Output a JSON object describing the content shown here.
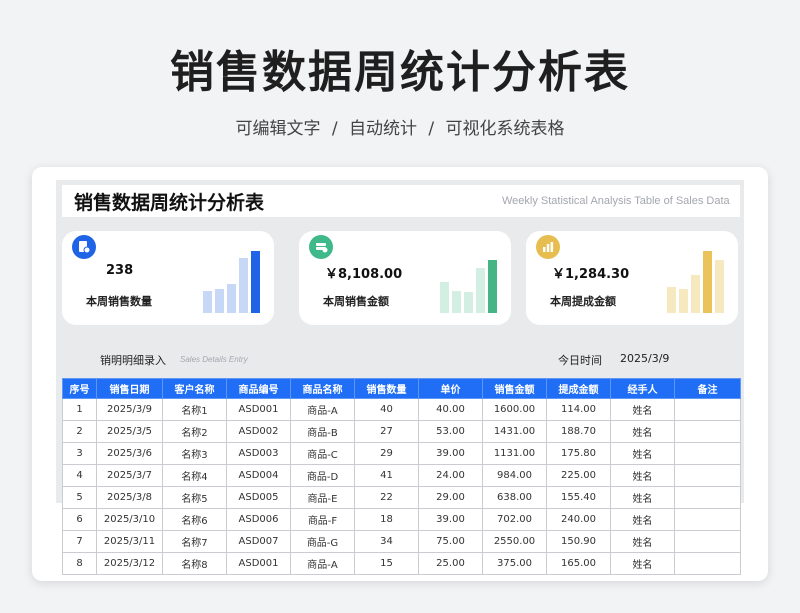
{
  "header": {
    "title": "销售数据周统计分析表",
    "subtitle": "可编辑文字 / 自动统计 / 可视化系统表格"
  },
  "sheet": {
    "title": "销售数据周统计分析表",
    "subtitle": "Weekly Statistical Analysis Table of Sales Data"
  },
  "kpis": [
    {
      "value": "238",
      "label": "本周销售数量",
      "icon": "document-user-icon",
      "accent": "#1f63e6",
      "bar_color": "#c6d8f6",
      "bar_last_color": "#1f63e6",
      "bars": [
        0.36,
        0.38,
        0.46,
        0.88,
        1.0
      ]
    },
    {
      "value": "￥8,108.00",
      "label": "本周销售金额",
      "icon": "money-stack-icon",
      "accent": "#3fb88a",
      "bar_color": "#d3eee2",
      "bar_last_color": "#45b585",
      "bars": [
        0.5,
        0.36,
        0.34,
        0.72,
        0.86
      ]
    },
    {
      "value": "￥1,284.30",
      "label": "本周提成金额",
      "icon": "bar-chart-icon",
      "accent": "#e7bd4f",
      "bar_color": "#f7e9bf",
      "bar_last_color": "#f7e9bf",
      "bars": [
        0.42,
        0.38,
        0.62,
        1.0,
        0.86
      ],
      "bar_highlight_index": 3,
      "bar_highlight_color": "#eac35a"
    }
  ],
  "details": {
    "label": "销明明细录入",
    "label_en": "Sales Details Entry",
    "today_label": "今日时间",
    "today_value": "2025/3/9"
  },
  "table": {
    "headers": [
      "序号",
      "销售日期",
      "客户名称",
      "商品编号",
      "商品名称",
      "销售数量",
      "单价",
      "销售金额",
      "提成金额",
      "经手人",
      "备注"
    ],
    "rows": [
      [
        "1",
        "2025/3/9",
        "名称1",
        "ASD001",
        "商品-A",
        "40",
        "40.00",
        "1600.00",
        "114.00",
        "姓名",
        ""
      ],
      [
        "2",
        "2025/3/5",
        "名称2",
        "ASD002",
        "商品-B",
        "27",
        "53.00",
        "1431.00",
        "188.70",
        "姓名",
        ""
      ],
      [
        "3",
        "2025/3/6",
        "名称3",
        "ASD003",
        "商品-C",
        "29",
        "39.00",
        "1131.00",
        "175.80",
        "姓名",
        ""
      ],
      [
        "4",
        "2025/3/7",
        "名称4",
        "ASD004",
        "商品-D",
        "41",
        "24.00",
        "984.00",
        "225.00",
        "姓名",
        ""
      ],
      [
        "5",
        "2025/3/8",
        "名称5",
        "ASD005",
        "商品-E",
        "22",
        "29.00",
        "638.00",
        "155.40",
        "姓名",
        ""
      ],
      [
        "6",
        "2025/3/10",
        "名称6",
        "ASD006",
        "商品-F",
        "18",
        "39.00",
        "702.00",
        "240.00",
        "姓名",
        ""
      ],
      [
        "7",
        "2025/3/11",
        "名称7",
        "ASD007",
        "商品-G",
        "34",
        "75.00",
        "2550.00",
        "150.90",
        "姓名",
        ""
      ],
      [
        "8",
        "2025/3/12",
        "名称8",
        "ASD001",
        "商品-A",
        "15",
        "25.00",
        "375.00",
        "165.00",
        "姓名",
        ""
      ]
    ]
  }
}
